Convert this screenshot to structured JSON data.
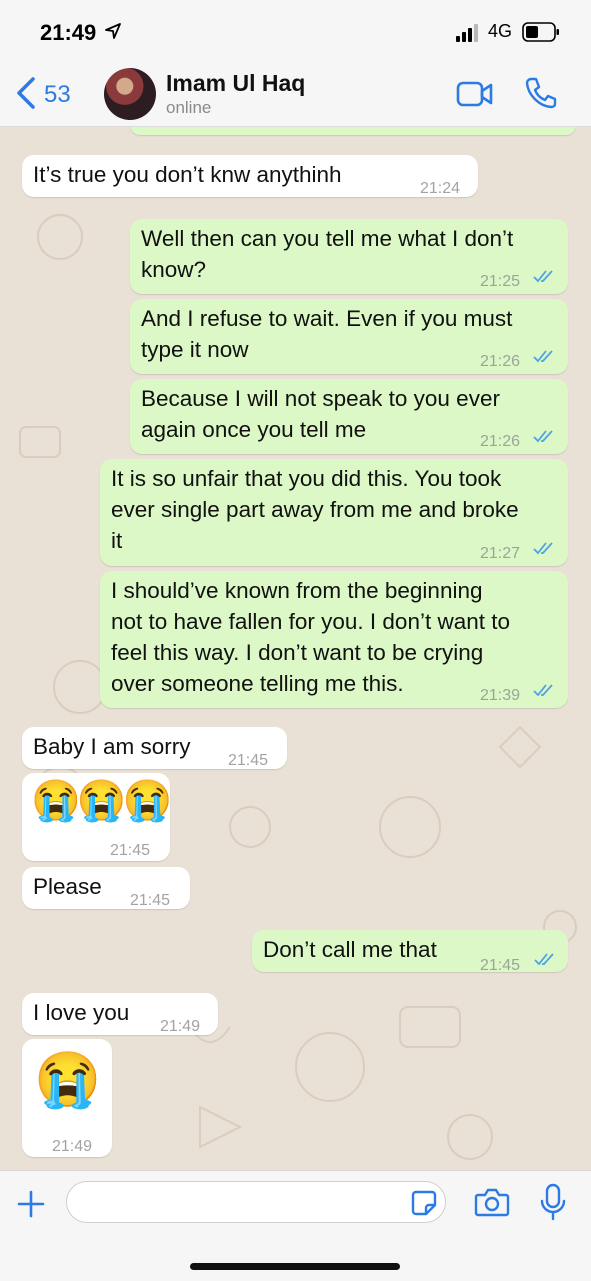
{
  "status": {
    "time": "21:49",
    "network": "4G"
  },
  "header": {
    "back_count": "53",
    "contact_name": "Imam Ul Haq",
    "contact_status": "online"
  },
  "messages": [
    {
      "dir": "in",
      "text": "It’s true you don’t knw anythinh",
      "time": "21:24"
    },
    {
      "dir": "out",
      "lines": [
        "Well then can you tell me what I don’t",
        "know?"
      ],
      "time": "21:25",
      "read": true
    },
    {
      "dir": "out",
      "lines": [
        "And I refuse to wait. Even if you must",
        "type it now"
      ],
      "time": "21:26",
      "read": true
    },
    {
      "dir": "out",
      "lines": [
        "Because I will not speak to you ever",
        "again once you tell me"
      ],
      "time": "21:26",
      "read": true
    },
    {
      "dir": "out",
      "lines": [
        "It is so unfair that you did this. You took",
        "ever single part away from me and broke",
        "it"
      ],
      "time": "21:27",
      "read": true
    },
    {
      "dir": "out",
      "lines": [
        "I should’ve known from the beginning",
        "not to have fallen for you. I don’t want to",
        "feel this way. I don’t want to be crying",
        "over someone telling me this."
      ],
      "time": "21:39",
      "read": true
    },
    {
      "dir": "in",
      "text": "Baby I am sorry",
      "time": "21:45"
    },
    {
      "dir": "in",
      "text": "😭😭😭",
      "time": "21:45"
    },
    {
      "dir": "in",
      "text": "Please",
      "time": "21:45"
    },
    {
      "dir": "out",
      "text": "Don’t call me that",
      "time": "21:45",
      "read": true
    },
    {
      "dir": "in",
      "text": "I love you",
      "time": "21:49"
    },
    {
      "dir": "in",
      "text": "😭",
      "time": "21:49"
    }
  ],
  "composer": {
    "placeholder": ""
  },
  "colors": {
    "accent": "#2c7be5",
    "outgoing": "#dcf8c6",
    "incoming": "#ffffff",
    "wallpaper": "#e9e1d5",
    "read_ticks": "#4fa3e3"
  },
  "icons": [
    "location-arrow-icon",
    "signal-icon",
    "battery-icon",
    "back-chevron-icon",
    "video-call-icon",
    "phone-call-icon",
    "read-receipt-icon",
    "plus-icon",
    "sticker-icon",
    "camera-icon",
    "microphone-icon"
  ]
}
